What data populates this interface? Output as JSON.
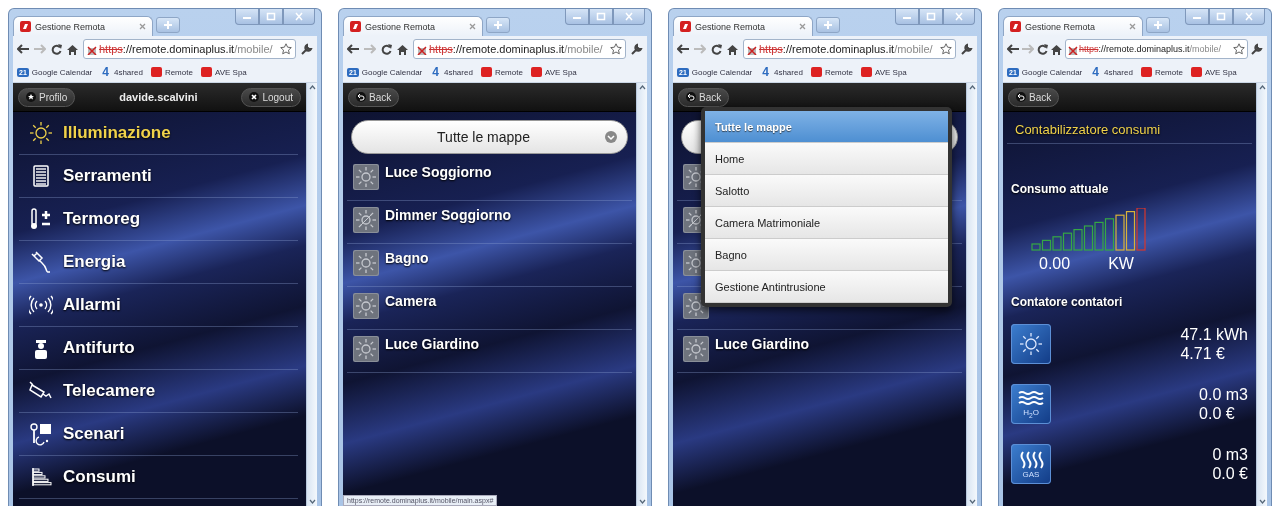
{
  "panels": [
    {
      "browser": {
        "tab_title": "Gestione Remota",
        "url_scheme": "https",
        "url_host": "://remote.dominaplus.it",
        "url_path": "/mobile/",
        "bookmarks": [
          {
            "kind": "calendar",
            "badge": "21",
            "label": "Google Calendar"
          },
          {
            "kind": "shared",
            "badge": "4",
            "label": "4shared"
          },
          {
            "kind": "site",
            "label": "Remote"
          },
          {
            "kind": "site",
            "label": "AVE Spa"
          }
        ]
      },
      "page": {
        "kind": "home",
        "header": {
          "left": {
            "kind": "profile",
            "label": "Profilo"
          },
          "title": "davide.scalvini",
          "right": {
            "kind": "logout",
            "label": "Logout"
          }
        },
        "menu": [
          {
            "kind": "sun",
            "label": "Illuminazione",
            "selected": true
          },
          {
            "kind": "blinds",
            "label": "Serramenti",
            "selected": false
          },
          {
            "kind": "thermo",
            "label": "Termoreg",
            "selected": false
          },
          {
            "kind": "plug",
            "label": "Energia",
            "selected": false
          },
          {
            "kind": "alarm",
            "label": "Allarmi",
            "selected": false
          },
          {
            "kind": "guard",
            "label": "Antifurto",
            "selected": false
          },
          {
            "kind": "camera",
            "label": "Telecamere",
            "selected": false
          },
          {
            "kind": "scene",
            "label": "Scenari",
            "selected": false
          },
          {
            "kind": "chart",
            "label": "Consumi",
            "selected": false
          }
        ]
      }
    },
    {
      "browser": {
        "tab_title": "Gestione Remota",
        "url_scheme": "https",
        "url_host": "://remote.dominaplus.it",
        "url_path": "/mobile/",
        "bookmarks": [
          {
            "kind": "calendar",
            "badge": "21",
            "label": "Google Calendar"
          },
          {
            "kind": "shared",
            "badge": "4",
            "label": "4shared"
          },
          {
            "kind": "site",
            "label": "Remote"
          },
          {
            "kind": "site",
            "label": "AVE Spa"
          }
        ]
      },
      "status_url": "https://remote.dominaplus.it/mobile/main.aspx#",
      "page": {
        "kind": "list",
        "header": {
          "left": {
            "kind": "back",
            "label": "Back"
          }
        },
        "select": {
          "label": "Tutte le mappe",
          "expanded": false
        },
        "items": [
          {
            "kind": "light",
            "label": "Luce Soggiorno"
          },
          {
            "kind": "dimmer",
            "label": "Dimmer Soggiorno"
          },
          {
            "kind": "light",
            "label": "Bagno"
          },
          {
            "kind": "light",
            "label": "Camera"
          },
          {
            "kind": "light",
            "label": "Luce Giardino"
          }
        ]
      }
    },
    {
      "browser": {
        "tab_title": "Gestione Remota",
        "url_scheme": "https",
        "url_host": "://remote.dominaplus.it",
        "url_path": "/mobile/",
        "bookmarks": [
          {
            "kind": "calendar",
            "badge": "21",
            "label": "Google Calendar"
          },
          {
            "kind": "shared",
            "badge": "4",
            "label": "4shared"
          },
          {
            "kind": "site",
            "label": "Remote"
          },
          {
            "kind": "site",
            "label": "AVE Spa"
          }
        ]
      },
      "page": {
        "kind": "list",
        "header": {
          "left": {
            "kind": "back",
            "label": "Back"
          }
        },
        "select": {
          "expanded": true,
          "options": [
            {
              "label": "Tutte le mappe",
              "selected": true
            },
            {
              "label": "Home",
              "selected": false
            },
            {
              "label": "Salotto",
              "selected": false
            },
            {
              "label": "Camera Matrimoniale",
              "selected": false
            },
            {
              "label": "Bagno",
              "selected": false
            },
            {
              "label": "Gestione Antintrusione",
              "selected": false
            }
          ]
        },
        "items": [
          {
            "kind": "light"
          },
          {
            "kind": "dimmer"
          },
          {
            "kind": "light"
          },
          {
            "kind": "light"
          },
          {
            "kind": "light",
            "label": "Luce Giardino"
          }
        ]
      }
    },
    {
      "browser": {
        "tab_title": "Gestione Remota",
        "url_scheme": "https",
        "url_host": "://remote.dominaplus.it",
        "url_path": "/mobile/",
        "bookmarks": [
          {
            "kind": "calendar",
            "badge": "21",
            "label": "Google Calendar"
          },
          {
            "kind": "shared",
            "badge": "4",
            "label": "4shared"
          },
          {
            "kind": "site",
            "label": "Remote"
          },
          {
            "kind": "site",
            "label": "AVE Spa"
          }
        ]
      },
      "page": {
        "kind": "consumption",
        "header": {
          "left": {
            "kind": "back",
            "label": "Back"
          }
        },
        "title": "Contabilizzatore consumi",
        "current": {
          "heading": "Consumo attuale",
          "value": "0.00",
          "unit": "KW"
        },
        "counters": {
          "heading": "Contatore contatori",
          "items": [
            {
              "kind": "electric",
              "amount": "47.1 kWh",
              "cost": "4.71 €"
            },
            {
              "kind": "water",
              "badge": "H$_{2}$O",
              "amount": "0.0 m3",
              "cost": "0.0 €"
            },
            {
              "kind": "gas",
              "badge": "GAS",
              "amount": "0 m3",
              "cost": "0.0 €"
            }
          ]
        }
      }
    }
  ]
}
